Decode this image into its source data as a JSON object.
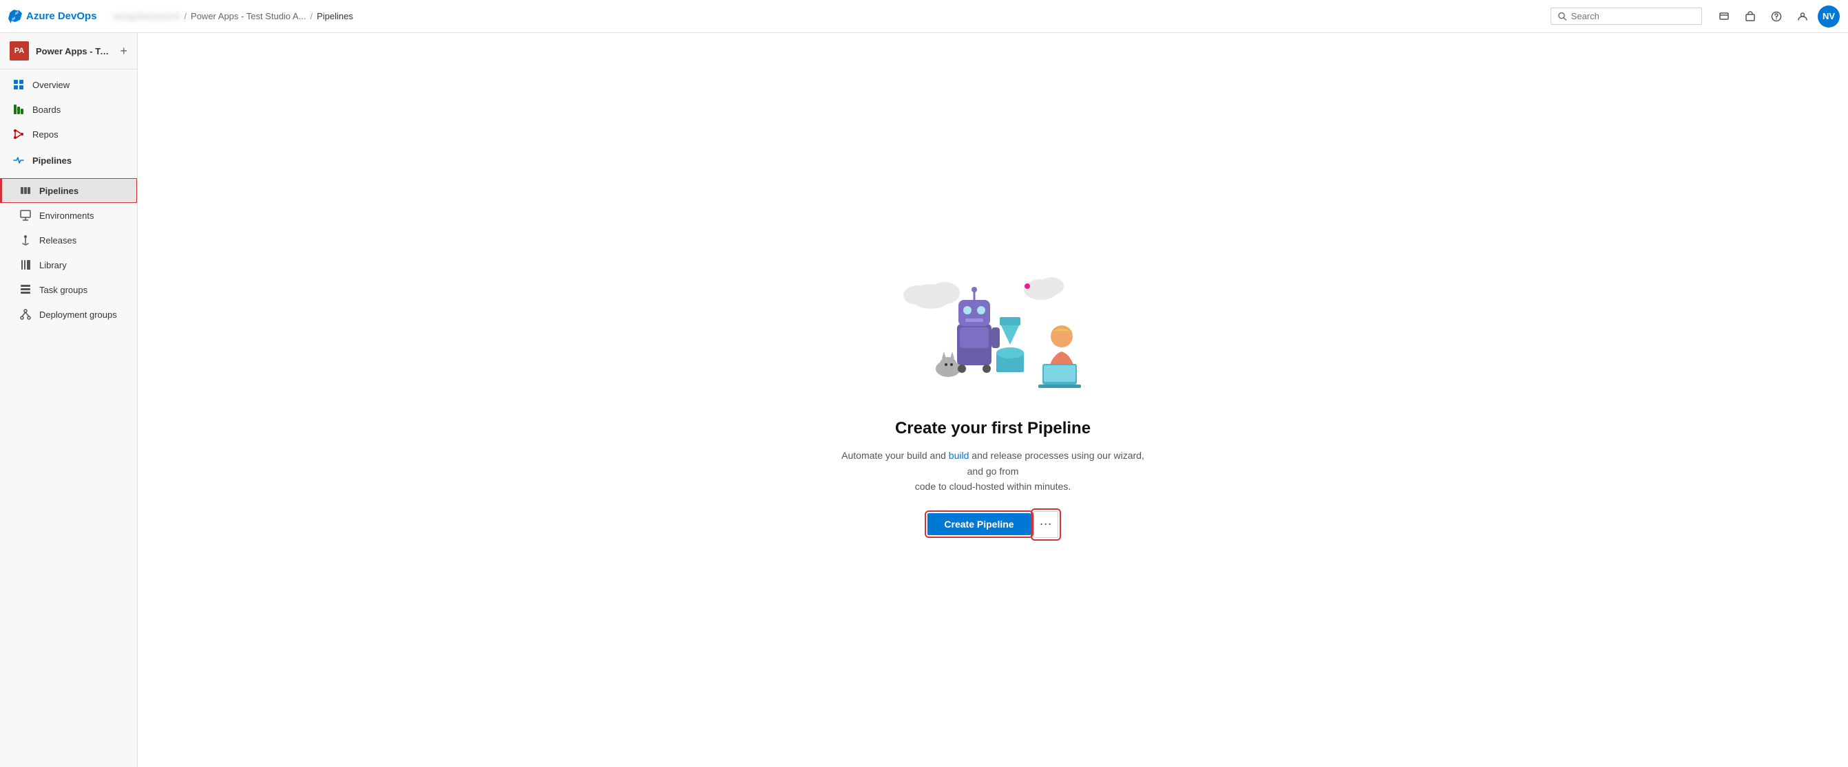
{
  "topbar": {
    "logo_text": "Azure DevOps",
    "breadcrumb_blurred": "aenguihearyarnit",
    "breadcrumb_sep1": "/",
    "breadcrumb_project": "Power Apps - Test Studio A...",
    "breadcrumb_sep2": "/",
    "breadcrumb_current": "Pipelines",
    "search_placeholder": "Search",
    "avatar_initials": "NV"
  },
  "sidebar": {
    "project_avatar": "PA",
    "project_name": "Power Apps - Test Stud...",
    "add_label": "+",
    "nav_items": [
      {
        "id": "overview",
        "label": "Overview",
        "icon": "overview"
      },
      {
        "id": "boards",
        "label": "Boards",
        "icon": "boards"
      },
      {
        "id": "repos",
        "label": "Repos",
        "icon": "repos"
      },
      {
        "id": "pipelines-header",
        "label": "Pipelines",
        "icon": "pipelines",
        "is_header": true
      }
    ],
    "sub_items": [
      {
        "id": "pipelines",
        "label": "Pipelines",
        "icon": "pipelines-sub",
        "active": true
      },
      {
        "id": "environments",
        "label": "Environments",
        "icon": "environments"
      },
      {
        "id": "releases",
        "label": "Releases",
        "icon": "releases"
      },
      {
        "id": "library",
        "label": "Library",
        "icon": "library"
      },
      {
        "id": "task-groups",
        "label": "Task groups",
        "icon": "task-groups"
      },
      {
        "id": "deployment-groups",
        "label": "Deployment groups",
        "icon": "deployment-groups"
      }
    ]
  },
  "main": {
    "title": "Create your first Pipeline",
    "description_part1": "Automate your build and ",
    "description_link1": "build",
    "description_part2": " and release processes using our wizard, and go from\ncode to cloud-hosted within minutes.",
    "description_text": "Automate your build and release processes using our wizard, and go from code to cloud-hosted within minutes.",
    "create_button": "Create Pipeline",
    "more_button": "⋯"
  }
}
